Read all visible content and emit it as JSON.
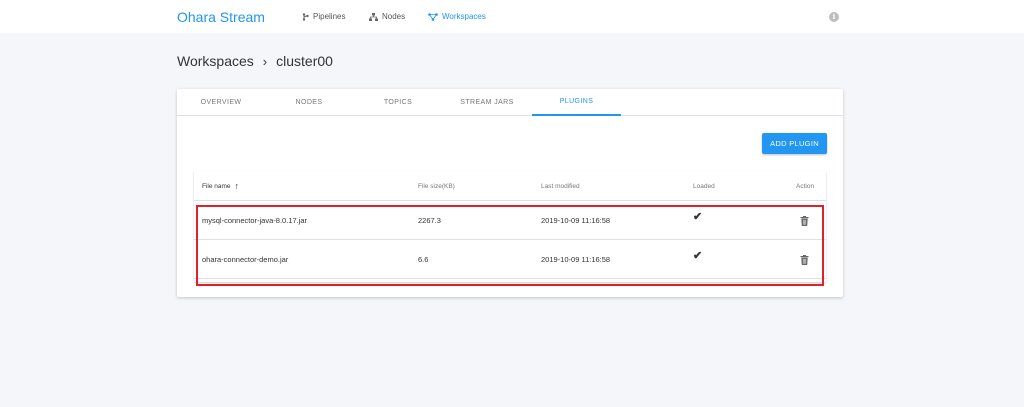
{
  "app": {
    "brand": "Ohara Stream"
  },
  "nav": [
    {
      "label": "Pipelines",
      "icon": "pipelines-icon"
    },
    {
      "label": "Nodes",
      "icon": "nodes-icon"
    },
    {
      "label": "Workspaces",
      "icon": "workspaces-icon",
      "active": true
    }
  ],
  "header": {
    "info_icon": "i"
  },
  "breadcrumb": {
    "root": "Workspaces",
    "separator": "›",
    "current": "cluster00"
  },
  "tabs": [
    "OVERVIEW",
    "NODES",
    "TOPICS",
    "STREAM JARS",
    "PLUGINS"
  ],
  "active_tab": "PLUGINS",
  "toolbar": {
    "add_label": "ADD PLUGIN"
  },
  "table": {
    "columns": [
      "File name",
      "File size(KB)",
      "Last modified",
      "Loaded",
      "Action"
    ],
    "sort_arrow": "↑",
    "rows": [
      {
        "name": "mysql-connector-java-8.0.17.jar",
        "size": "2267.3",
        "modified": "2019-10-09 11:16:58",
        "loaded": "✔"
      },
      {
        "name": "ohara-connector-demo.jar",
        "size": "6.6",
        "modified": "2019-10-09 11:16:58",
        "loaded": "✔"
      }
    ]
  },
  "colors": {
    "accent": "#2196f3",
    "highlight": "#e0202a",
    "background": "#f5f6fa"
  }
}
